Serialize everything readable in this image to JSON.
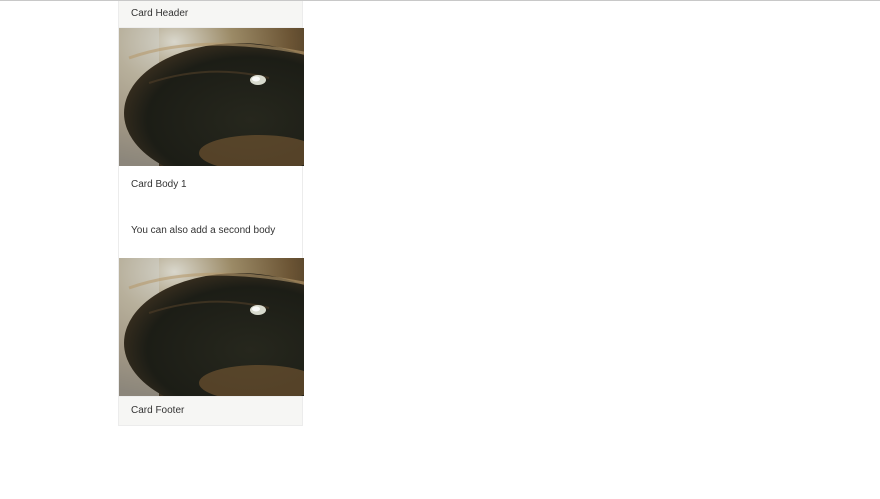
{
  "card": {
    "header": "Card Header",
    "body_1": "Card Body 1",
    "body_2": "You can also add a second body",
    "footer": "Card Footer",
    "image_1": "eye-photo",
    "image_2": "eye-photo"
  }
}
